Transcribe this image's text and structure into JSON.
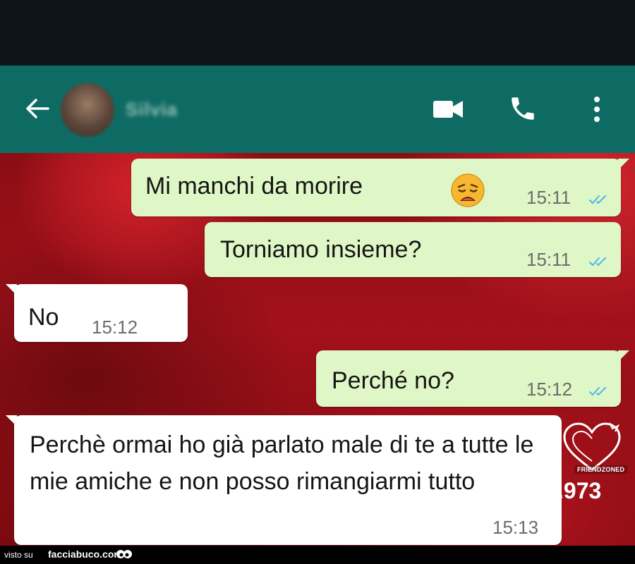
{
  "header": {
    "contact_name": "Silvia",
    "icons": [
      "back-arrow-icon",
      "video-call-icon",
      "phone-icon",
      "more-vert-icon"
    ]
  },
  "messages": [
    {
      "direction": "out",
      "text": "Mi manchi da morire",
      "emoji": "weary-face",
      "time": "15:11",
      "status": "read"
    },
    {
      "direction": "out",
      "text": "Torniamo insieme?",
      "time": "15:11",
      "status": "read"
    },
    {
      "direction": "in",
      "text": "No",
      "time": "15:12"
    },
    {
      "direction": "out",
      "text": "Perché no?",
      "time": "15:12",
      "status": "read"
    },
    {
      "direction": "in",
      "text": "Perchè ormai ho già parlato male di te a tutte le mie amiche e non posso rimangiarmi tutto",
      "time": "15:13"
    }
  ],
  "overlay": {
    "count": ".973",
    "badge": "FRIENDZONED"
  },
  "footer": {
    "visto": "visto su",
    "site": "facciabuco.com"
  },
  "colors": {
    "header": "#0e6b63",
    "bubble_out": "#dff7c6",
    "bubble_in": "#ffffff",
    "read_ticks": "#4fb6ec"
  }
}
